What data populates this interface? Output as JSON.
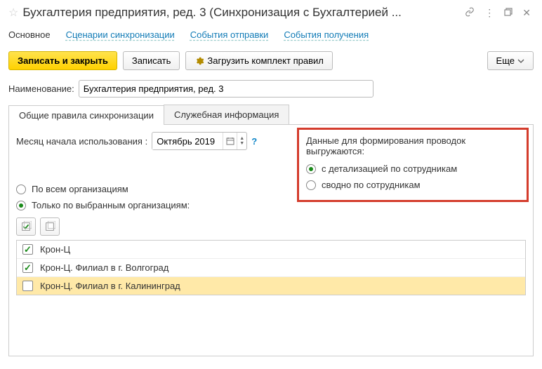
{
  "title": "Бухгалтерия предприятия, ред. 3 (Синхронизация с Бухгалтерией ...",
  "nav": {
    "main": "Основное",
    "scenarios": "Сценарии синхронизации",
    "send_events": "События отправки",
    "recv_events": "События получения"
  },
  "toolbar": {
    "save_close": "Записать и закрыть",
    "save": "Записать",
    "load_rules": "Загрузить комплект правил",
    "more": "Еще"
  },
  "fields": {
    "name_label": "Наименование:",
    "name_value": "Бухгалтерия предприятия, ред. 3"
  },
  "tabs": {
    "general": "Общие правила синхронизации",
    "service": "Служебная информация"
  },
  "month": {
    "label": "Месяц начала использования :",
    "value": "Октябрь 2019",
    "help": "?"
  },
  "posting": {
    "title": "Данные для формирования проводок выгружаются:",
    "opt1": "с детализацией по сотрудникам",
    "opt2": "сводно по сотрудникам",
    "selected": "opt1"
  },
  "org_filter": {
    "all": "По всем организациям",
    "selected_only": "Только по выбранным организациям:",
    "selected": "selected_only"
  },
  "orgs": [
    {
      "name": "Крон-Ц",
      "checked": true,
      "highlighted": false
    },
    {
      "name": "Крон-Ц. Филиал в г. Волгоград",
      "checked": true,
      "highlighted": false
    },
    {
      "name": "Крон-Ц. Филиал в г. Калининград",
      "checked": false,
      "highlighted": true
    }
  ]
}
